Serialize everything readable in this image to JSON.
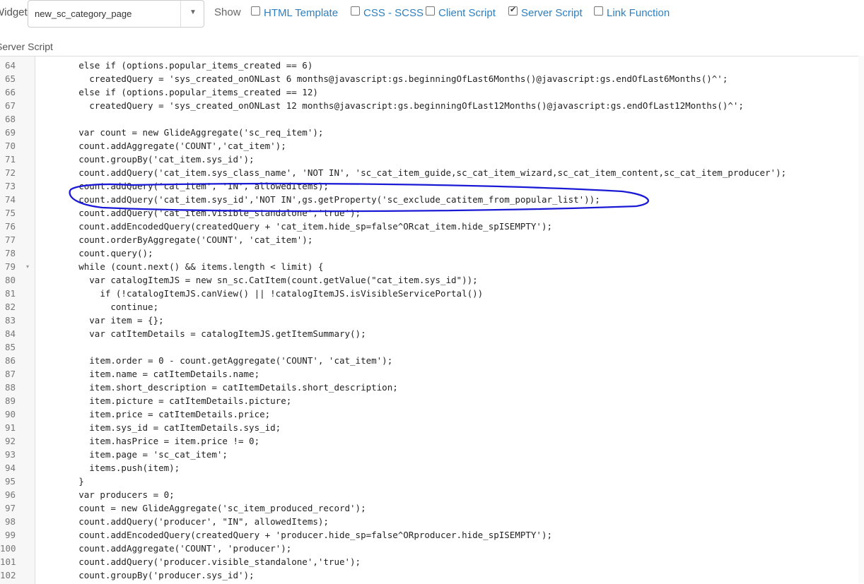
{
  "toolbar": {
    "widget_label": "Widget",
    "widget_value": "new_sc_category_page",
    "show_label": "Show",
    "options": [
      {
        "label": "HTML Template",
        "checked": false
      },
      {
        "label": "CSS - SCSS",
        "checked": false
      },
      {
        "label": "Client Script",
        "checked": false
      },
      {
        "label": "Server Script",
        "checked": true
      },
      {
        "label": "Link Function",
        "checked": false
      }
    ]
  },
  "section": {
    "title": "Server Script"
  },
  "editor": {
    "lines": [
      {
        "num": "64",
        "code": "\telse if (options.popular_items_created == 6)"
      },
      {
        "num": "65",
        "code": "\t  createdQuery = 'sys_created_onONLast 6 months@javascript:gs.beginningOfLast6Months()@javascript:gs.endOfLast6Months()^';"
      },
      {
        "num": "66",
        "code": "\telse if (options.popular_items_created == 12)"
      },
      {
        "num": "67",
        "code": "\t  createdQuery = 'sys_created_onONLast 12 months@javascript:gs.beginningOfLast12Months()@javascript:gs.endOfLast12Months()^';"
      },
      {
        "num": "68",
        "code": ""
      },
      {
        "num": "69",
        "code": "\tvar count = new GlideAggregate('sc_req_item');"
      },
      {
        "num": "70",
        "code": "\tcount.addAggregate('COUNT','cat_item');"
      },
      {
        "num": "71",
        "code": "\tcount.groupBy('cat_item.sys_id');"
      },
      {
        "num": "72",
        "code": "\tcount.addQuery('cat_item.sys_class_name', 'NOT IN', 'sc_cat_item_guide,sc_cat_item_wizard,sc_cat_item_content,sc_cat_item_producer');"
      },
      {
        "num": "73",
        "code": "\tcount.addQuery('cat_item', 'IN', allowedItems);"
      },
      {
        "num": "74",
        "code": "\tcount.addQuery('cat_item.sys_id','NOT IN',gs.getProperty('sc_exclude_catitem_from_popular_list'));"
      },
      {
        "num": "75",
        "code": "\tcount.addQuery('cat_item.visible_standalone','true');"
      },
      {
        "num": "76",
        "code": "\tcount.addEncodedQuery(createdQuery + 'cat_item.hide_sp=false^ORcat_item.hide_spISEMPTY');"
      },
      {
        "num": "77",
        "code": "\tcount.orderByAggregate('COUNT', 'cat_item');"
      },
      {
        "num": "78",
        "code": "\tcount.query();"
      },
      {
        "num": "79",
        "code": "\twhile (count.next() && items.length < limit) {",
        "fold": true
      },
      {
        "num": "80",
        "code": "\t  var catalogItemJS = new sn_sc.CatItem(count.getValue(\"cat_item.sys_id\"));"
      },
      {
        "num": "81",
        "code": "\t    if (!catalogItemJS.canView() || !catalogItemJS.isVisibleServicePortal())"
      },
      {
        "num": "82",
        "code": "\t      continue;"
      },
      {
        "num": "83",
        "code": "\t  var item = {};"
      },
      {
        "num": "84",
        "code": "\t  var catItemDetails = catalogItemJS.getItemSummary();"
      },
      {
        "num": "85",
        "code": ""
      },
      {
        "num": "86",
        "code": "\t  item.order = 0 - count.getAggregate('COUNT', 'cat_item');"
      },
      {
        "num": "87",
        "code": "\t  item.name = catItemDetails.name;"
      },
      {
        "num": "88",
        "code": "\t  item.short_description = catItemDetails.short_description;"
      },
      {
        "num": "89",
        "code": "\t  item.picture = catItemDetails.picture;"
      },
      {
        "num": "90",
        "code": "\t  item.price = catItemDetails.price;"
      },
      {
        "num": "91",
        "code": "\t  item.sys_id = catItemDetails.sys_id;"
      },
      {
        "num": "92",
        "code": "\t  item.hasPrice = item.price != 0;"
      },
      {
        "num": "93",
        "code": "\t  item.page = 'sc_cat_item';"
      },
      {
        "num": "94",
        "code": "\t  items.push(item);"
      },
      {
        "num": "95",
        "code": "\t}"
      },
      {
        "num": "96",
        "code": "\tvar producers = 0;"
      },
      {
        "num": "97",
        "code": "\tcount = new GlideAggregate('sc_item_produced_record');"
      },
      {
        "num": "98",
        "code": "\tcount.addQuery('producer', \"IN\", allowedItems);"
      },
      {
        "num": "99",
        "code": "\tcount.addEncodedQuery(createdQuery + 'producer.hide_sp=false^ORproducer.hide_spISEMPTY');"
      },
      {
        "num": "100",
        "code": "\tcount.addAggregate('COUNT', 'producer');"
      },
      {
        "num": "101",
        "code": "\tcount.addQuery('producer.visible_standalone','true');"
      },
      {
        "num": "102",
        "code": "\tcount.groupBy('producer.sys_id');"
      }
    ]
  }
}
